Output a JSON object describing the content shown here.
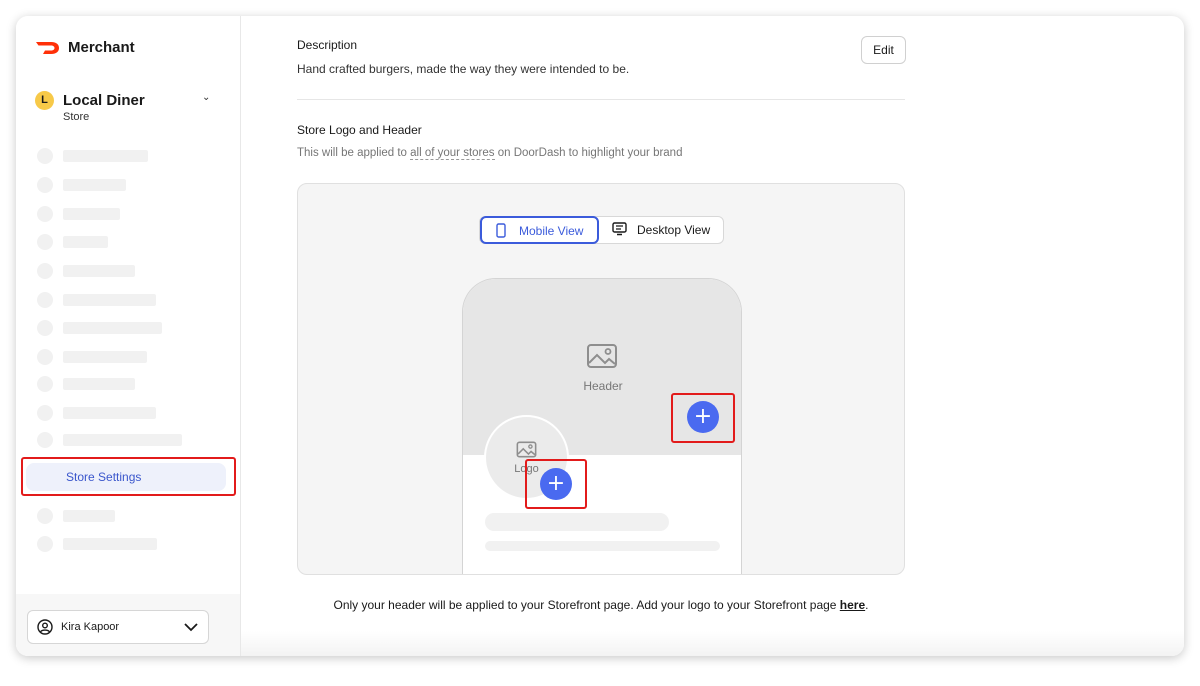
{
  "brand": {
    "name": "Merchant",
    "color": "#ff3008"
  },
  "store": {
    "initial": "L",
    "name": "Local Diner",
    "type": "Store"
  },
  "sidebar": {
    "active_item": "Store Settings"
  },
  "user": {
    "name": "Kira Kapoor"
  },
  "description": {
    "label": "Description",
    "text": "Hand crafted burgers, made the way they were intended to be.",
    "edit_label": "Edit"
  },
  "logo_header": {
    "label": "Store Logo and Header",
    "help_prefix": "This will be applied to ",
    "help_link": "all of your stores",
    "help_suffix": " on DoorDash to highlight your brand"
  },
  "preview": {
    "mobile_label": "Mobile View",
    "desktop_label": "Desktop View",
    "header_label": "Header",
    "logo_label": "Logo",
    "accent_color": "#4a6af0"
  },
  "footer": {
    "text": "Only your header will be applied to your Storefront page. Add your logo to your Storefront page ",
    "link": "here",
    "end": "."
  }
}
